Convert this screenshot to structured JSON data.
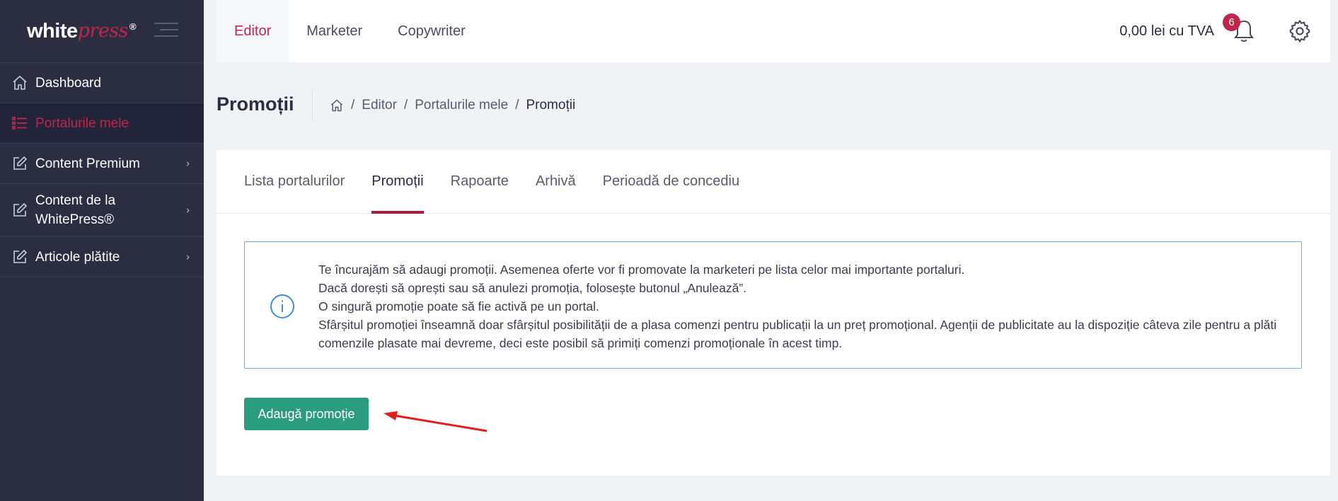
{
  "brand": {
    "part1": "white",
    "part2": "press",
    "reg": "®"
  },
  "sidebar": {
    "items": [
      {
        "label": "Dashboard",
        "icon": "home-icon"
      },
      {
        "label": "Portalurile mele",
        "icon": "list-icon",
        "active": true
      },
      {
        "label": "Content Premium",
        "icon": "edit-icon"
      },
      {
        "label": "Content de la WhitePress®",
        "icon": "edit-icon"
      },
      {
        "label": "Articole plătite",
        "icon": "edit-icon"
      }
    ]
  },
  "topbar": {
    "tabs": [
      "Editor",
      "Marketer",
      "Copywriter"
    ],
    "balance": "0,00 lei cu TVA",
    "notifications": "6"
  },
  "page": {
    "title": "Promoții",
    "breadcrumb": [
      "Editor",
      "Portalurile mele",
      "Promoții"
    ]
  },
  "tabs": [
    "Lista portalurilor",
    "Promoții",
    "Rapoarte",
    "Arhivă",
    "Perioadă de concediu"
  ],
  "info": {
    "line1": "Te încurajăm să adaugi promoții. Asemenea oferte vor fi promovate la marketeri pe lista celor mai importante portaluri.",
    "line2": "Dacă dorești să oprești sau să anulezi promoția, folosește butonul „Anulează”.",
    "line3": "O singură promoție poate să fie activă pe un portal.",
    "line4": "Sfârșitul promoției înseamnă doar sfârșitul posibilității de a plasa comenzi pentru publicații la un preț promoțional. Agenții de publicitate au la dispoziție câteva zile pentru a plăti comenzile plasate mai devreme, deci este posibil să primiți comenzi promoționale în acest timp."
  },
  "actions": {
    "add_promotion": "Adaugă promoție"
  },
  "colors": {
    "accent": "#c0264b",
    "sidebar": "#2b2d41",
    "button": "#2a9d7e",
    "info_border": "#6aaee0",
    "arrow": "#e01e1e"
  }
}
